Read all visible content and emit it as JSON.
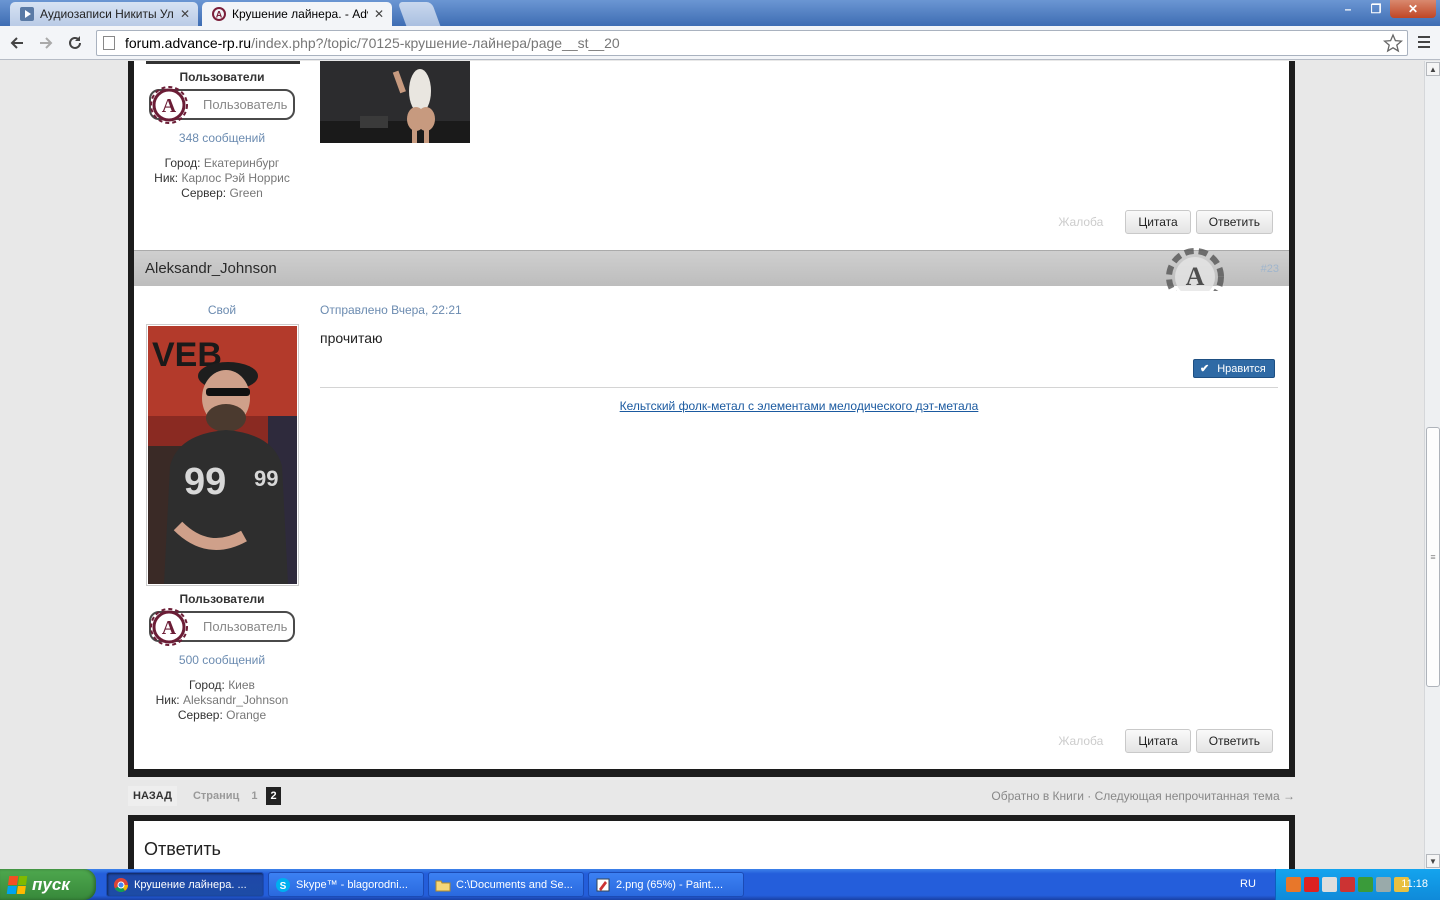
{
  "browser": {
    "tabs": [
      {
        "title": "Аудиозаписи Никиты Ульяно",
        "active": false
      },
      {
        "title": "Крушение лайнера. - Advanc",
        "active": true
      }
    ],
    "url_host": "forum.advance-rp.ru",
    "url_path": "/index.php?/topic/70125-крушение-лайнера/page__st__20"
  },
  "posts": [
    {
      "user": {
        "group": "Пользователи",
        "rank": "Пользователь",
        "posts_count": "348 сообщений",
        "fields": [
          {
            "label": "Город:",
            "value": "Екатеринбург"
          },
          {
            "label": "Ник:",
            "value": "Карлос Рэй Норрис"
          },
          {
            "label": "Сервер:",
            "value": "Green"
          }
        ]
      },
      "actions": {
        "report": "Жалоба",
        "quote": "Цитата",
        "reply": "Ответить"
      }
    },
    {
      "author": "Aleksandr_Johnson",
      "post_number": "#23",
      "user": {
        "title": "Свой",
        "group": "Пользователи",
        "rank": "Пользователь",
        "posts_count": "500 сообщений",
        "fields": [
          {
            "label": "Город:",
            "value": "Киев"
          },
          {
            "label": "Ник:",
            "value": "Aleksandr_Johnson"
          },
          {
            "label": "Сервер:",
            "value": "Orange"
          }
        ]
      },
      "date": "Отправлено Вчера, 22:21",
      "body": "прочитаю",
      "like_label": "Нравится",
      "signature": "Кельтский фолк-метал с элементами мелодического дэт-метала",
      "actions": {
        "report": "Жалоба",
        "quote": "Цитата",
        "reply": "Ответить"
      }
    }
  ],
  "pagination": {
    "back": "НАЗАД",
    "label": "Страниц",
    "pages": [
      "1",
      "2"
    ],
    "current": "2",
    "links": "Обратно в Книги · Следующая непрочитанная тема →"
  },
  "reply_section": {
    "title": "Ответить"
  },
  "taskbar": {
    "start": "пуск",
    "tasks": [
      {
        "label": "Крушение лайнера. ...",
        "active": true
      },
      {
        "label": "Skype™ - blagorodni...",
        "active": false
      },
      {
        "label": "C:\\Documents and Se...",
        "active": false
      },
      {
        "label": "2.png (65%) - Paint....",
        "active": false
      }
    ],
    "language": "RU",
    "clock": "11:18"
  }
}
